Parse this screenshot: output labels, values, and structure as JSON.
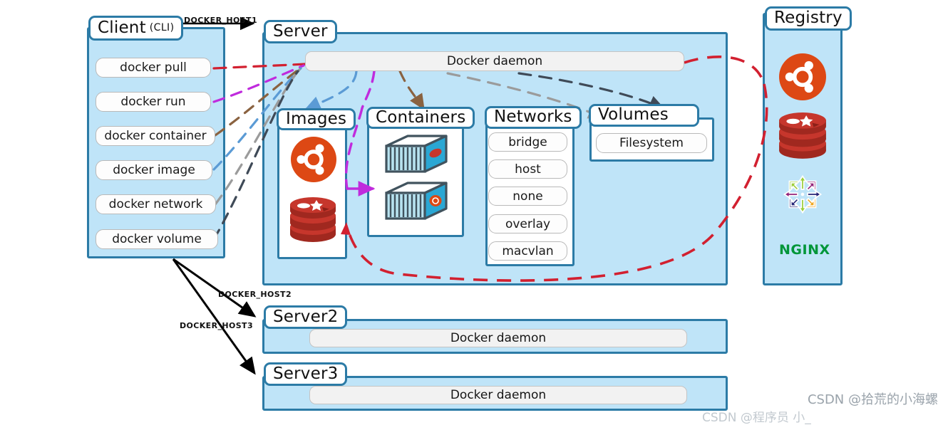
{
  "diagram": {
    "title": "Docker architecture",
    "colors": {
      "panel_fill": "#bfe4f8",
      "panel_border": "#2c7ba6",
      "pill_fill": "#fdfdfd",
      "daemon_fill": "#f2f2f2",
      "flow_pull": "#d22030",
      "flow_run": "#c02bdd",
      "flow_container": "#8a6240",
      "flow_image": "#5b9bd5",
      "flow_network": "#9b9b9b",
      "flow_volume": "#3f4a57",
      "ubuntu_orange": "#dd4814",
      "redis_red": "#c6362c",
      "nginx_green": "#009639"
    }
  },
  "client": {
    "label": "Client",
    "sub_label": "(CLI)",
    "commands": [
      {
        "label": "docker pull",
        "flow_color": "#d22030"
      },
      {
        "label": "docker run",
        "flow_color": "#c02bdd"
      },
      {
        "label": "docker container",
        "flow_color": "#8a6240"
      },
      {
        "label": "docker image",
        "flow_color": "#5b9bd5"
      },
      {
        "label": "docker network",
        "flow_color": "#9b9b9b"
      },
      {
        "label": "docker volume",
        "flow_color": "#3f4a57"
      }
    ]
  },
  "connections": [
    {
      "label": "DOCKER_HOST1",
      "from": "client",
      "to": "server1"
    },
    {
      "label": "DOCKER_HOST2",
      "from": "client",
      "to": "server2"
    },
    {
      "label": "DOCKER_HOST3",
      "from": "client",
      "to": "server3"
    }
  ],
  "server": {
    "label": "Server",
    "daemon_label": "Docker daemon",
    "sections": {
      "images": {
        "label": "Images",
        "items": [
          "ubuntu-logo",
          "redis-logo"
        ]
      },
      "containers": {
        "label": "Containers",
        "items": [
          "container-redis",
          "container-ubuntu"
        ]
      },
      "networks": {
        "label": "Networks",
        "items": [
          "bridge",
          "host",
          "none",
          "overlay",
          "macvlan"
        ]
      },
      "volumes": {
        "label": "Volumes",
        "items": [
          "Filesystem"
        ]
      }
    }
  },
  "server2": {
    "label": "Server2",
    "daemon_label": "Docker daemon"
  },
  "server3": {
    "label": "Server3",
    "daemon_label": "Docker daemon"
  },
  "registry": {
    "label": "Registry",
    "images": [
      "ubuntu-logo",
      "redis-logo",
      "centos-logo",
      "nginx-logo"
    ],
    "nginx_text": "NGINX"
  },
  "watermark": {
    "text": "CSDN @拾荒的小海螺",
    "text2": "CSDN @程序员 小_"
  }
}
